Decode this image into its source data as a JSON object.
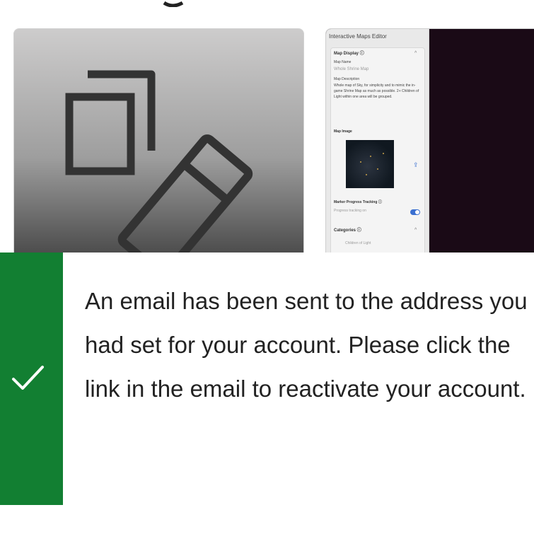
{
  "preview_card": {
    "title": "Interactive Maps Editor",
    "section_map_display": "Map Display",
    "map_name_label": "Map Name",
    "map_name_value": "Whole Shrine Map",
    "map_description_label": "Map Description",
    "map_description_value": "Whole map of Sky, for simplicity and to mimic the in-game Shrine Map as much as possible. 2+ Children of Light within one area will be grouped.",
    "map_image_label": "Map Image",
    "marker_progress_label": "Marker Progress Tracking",
    "progress_tracking_value": "Progress tracking on",
    "categories_label": "Categories",
    "category_item": "Children of Light",
    "caret": "^",
    "upload_glyph": "⇪",
    "help_glyph": "ⓘ"
  },
  "toast": {
    "status": "success",
    "message": "An email has been sent to the address you had set for your account. Please click the link in the email to reactivate your account.",
    "accent_color": "#127f32"
  }
}
